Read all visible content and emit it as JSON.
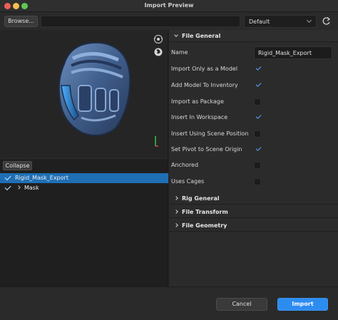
{
  "window": {
    "title": "Import Preview"
  },
  "toolbar": {
    "browse_label": "Browse...",
    "path_value": "",
    "preset_value": "Default"
  },
  "viewport": {
    "model_icon": "helmet-model",
    "icons": [
      "orbit-icon",
      "globe-icon"
    ]
  },
  "tree": {
    "collapse_label": "Collapse",
    "items": [
      {
        "label": "Rigid_Mask_Export",
        "checked": true,
        "selected": true
      },
      {
        "label": "Mask",
        "checked": true,
        "selected": false
      }
    ]
  },
  "sections": {
    "file_general": "File General",
    "rig_general": "Rig General",
    "file_transform": "File Transform",
    "file_geometry": "File Geometry"
  },
  "file_general": {
    "name_label": "Name",
    "name_value": "Rigid_Mask_Export",
    "options": [
      {
        "label": "Import Only as a Model",
        "checked": true
      },
      {
        "label": "Add Model To Inventory",
        "checked": true
      },
      {
        "label": "Import as Package",
        "checked": false
      },
      {
        "label": "Insert In Workspace",
        "checked": true
      },
      {
        "label": "Insert Using Scene Position",
        "checked": false
      },
      {
        "label": "Set Pivot to Scene Origin",
        "checked": true
      },
      {
        "label": "Anchored",
        "checked": false
      },
      {
        "label": "Uses Cages",
        "checked": false
      }
    ]
  },
  "footer": {
    "cancel_label": "Cancel",
    "import_label": "Import"
  },
  "colors": {
    "accent": "#2d8cf0",
    "selection": "#1f6fb5",
    "check": "#5aa6ff"
  }
}
